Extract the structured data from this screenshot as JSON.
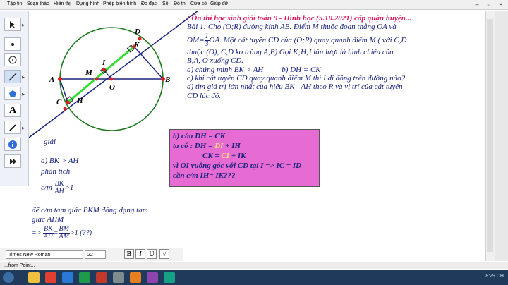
{
  "menu": [
    "Tập tin",
    "Soạn thảo",
    "Hiển thị",
    "Dựng hình",
    "Phép biến hình",
    "Đo đạc",
    "Số",
    "Đồ thị",
    "Cửa sổ",
    "Giúp đỡ"
  ],
  "problem": {
    "title": "( Ôn thi học sinh giỏi toán 9 - Hình học (5.10.2021) cấp quận huyện...",
    "line1": "Bài 1: Cho (O;R) đường kính AB. Điểm M thuộc đoạn thẳng OA và",
    "line2_pre": "OM=",
    "frac_num": "1",
    "frac_den": "3",
    "line2_post": "OA. Một cát tuyến CD của (O;R) quay quanh điểm M ( với C,D",
    "line3": "thuộc (O), C,D ko trùng A,B).Gọi K;H;I lần lượt là hình chiếu của",
    "line4": "B,A, O xuống CD.",
    "line5a": "a) chứng minh BK > AH",
    "line5b": "b) DH = CK",
    "line6": "c) khi cát tuyến CD quay quanh điểm M thì I di động trên đường nào?",
    "line7": "d) tìm giá trị lớn nhất của hiệu BK - AH theo R và vị trí của cát tuyến",
    "line8": "CD lúc đó."
  },
  "points": {
    "A": "A",
    "B": "B",
    "C": "C",
    "D": "D",
    "H": "H",
    "K": "K",
    "I": "I",
    "M": "M",
    "O": "O"
  },
  "solution": {
    "giai": "giải",
    "a": "a) BK > AH",
    "phantich": "phân tích",
    "cm": "c/m",
    "cm_num": "BK",
    "cm_den": "AH",
    "cm_tail": ">1",
    "de_cm": "để c/m tam giác BKM đồng dạng tam",
    "giac": "giác AHM",
    "imply": "=>",
    "f1_num": "BK",
    "f1_den": "AH",
    "eq": "=",
    "f2_num": "BM",
    "f2_den": "AM",
    "tail": ">1 (??)"
  },
  "pinkbox": {
    "l1": "b) c/m DH = CK",
    "l2_pre": "ta có : DH = ",
    "l2_hl": "DI",
    "l2_post": " + IH",
    "l3_pre": "CK = ",
    "l3_hl": "CI",
    "l3_post": " + IK",
    "l4": "vì OI vuông góc với CD tại I => IC = ID",
    "l5": "cần c/m IH= IK???"
  },
  "fontbar": {
    "font": "Times New Roman",
    "size": "22",
    "bold": "B",
    "italic": "I",
    "underline": "U"
  },
  "status": "...from Point...",
  "clock": "8:29 CH",
  "colors": {
    "pink": "#e66bd3",
    "text": "#1a237e",
    "title": "#d81b60",
    "circle": "#1b7a1b",
    "segment": "#33dd33"
  }
}
